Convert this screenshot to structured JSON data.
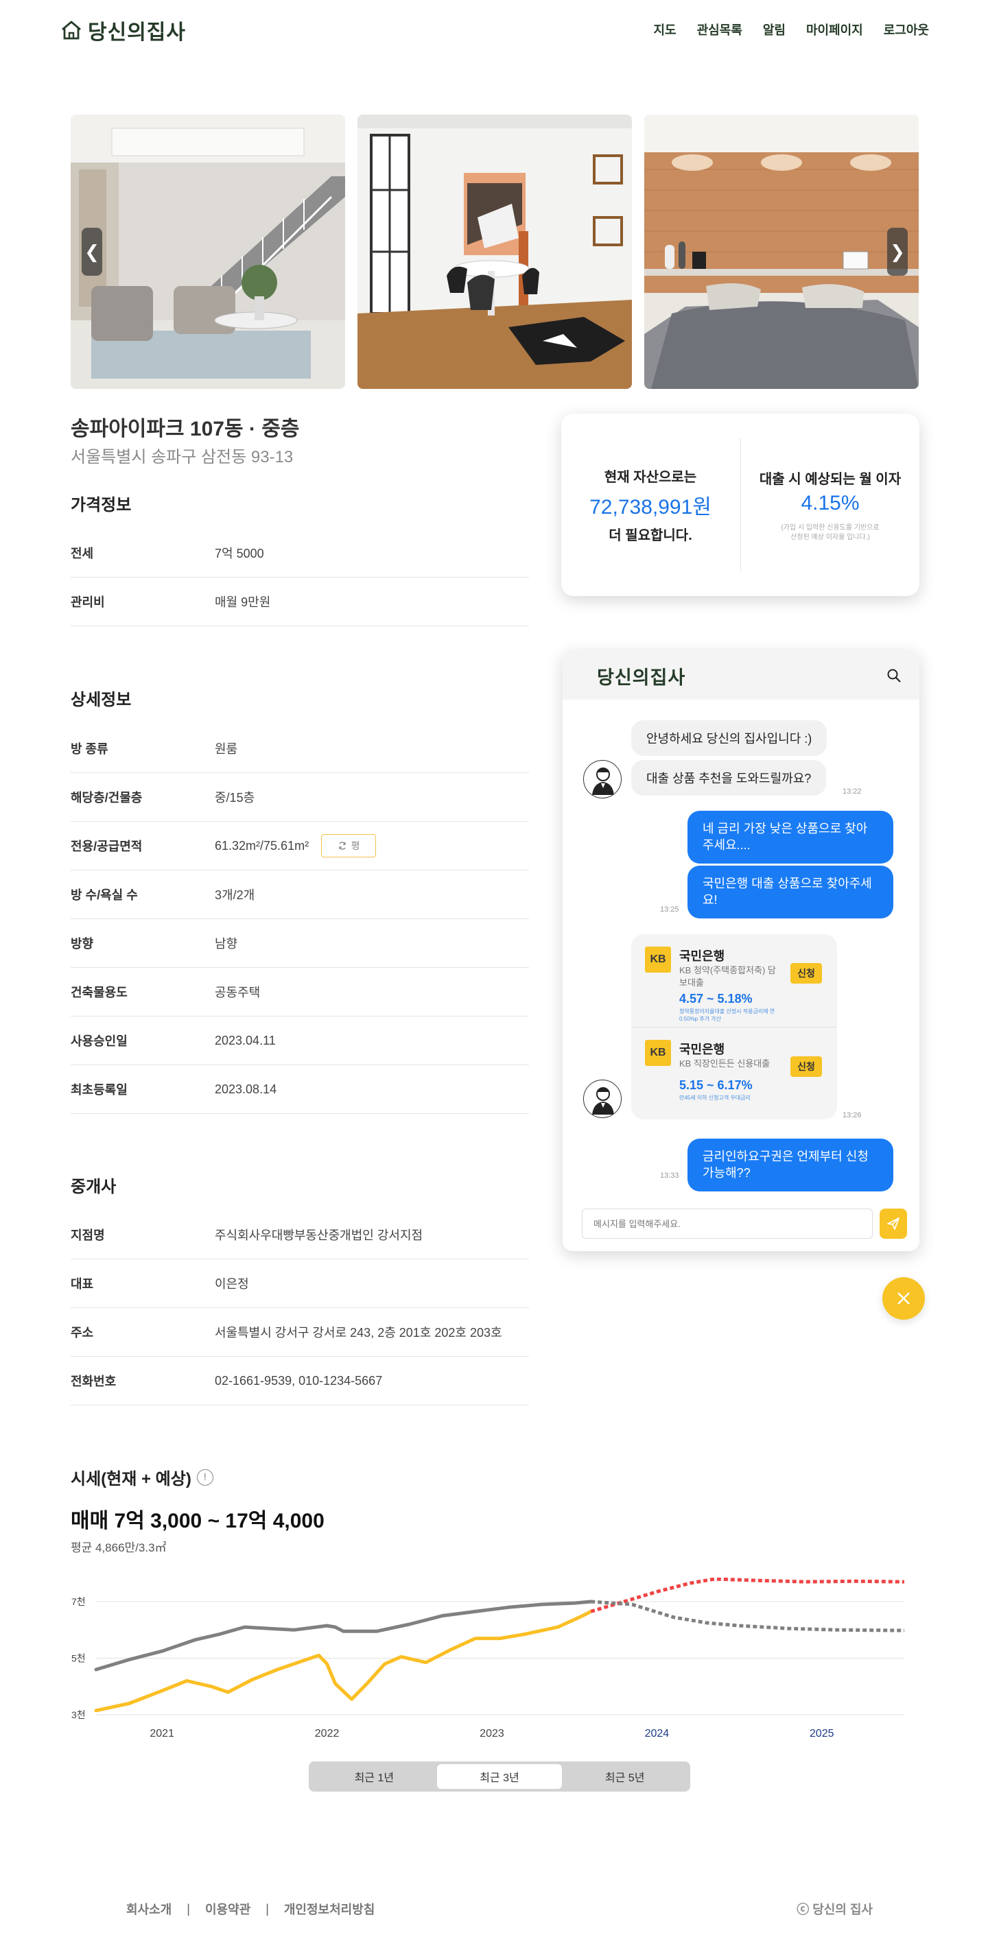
{
  "header": {
    "logo": "당신의집사",
    "nav": [
      "지도",
      "관심목록",
      "알림",
      "마이페이지",
      "로그아웃"
    ]
  },
  "gallery": {
    "prev_label": "❮",
    "next_label": "❯"
  },
  "listing": {
    "title": "송파아이파크 107동 · 중층",
    "address": "서울특별시 송파구 삼전동 93-13"
  },
  "price_info": {
    "title": "가격정보",
    "rows": [
      {
        "label": "전세",
        "value": "7억 5000"
      },
      {
        "label": "관리비",
        "value": "매월 9만원"
      }
    ]
  },
  "detail_info": {
    "title": "상세정보",
    "rows": [
      {
        "label": "방 종류",
        "value": "원룸"
      },
      {
        "label": "해당층/건물층",
        "value": "중/15층"
      },
      {
        "label": "전용/공급면적",
        "value": "61.32m²/75.61m²"
      },
      {
        "label": "방 수/욕실 수",
        "value": "3개/2개"
      },
      {
        "label": "방향",
        "value": "남향"
      },
      {
        "label": "건축물용도",
        "value": "공동주택"
      },
      {
        "label": "사용승인일",
        "value": "2023.04.11"
      },
      {
        "label": "최초등록일",
        "value": "2023.08.14"
      }
    ],
    "unit_toggle": "평"
  },
  "agency": {
    "title": "중개사",
    "rows": [
      {
        "label": "지점명",
        "value": "주식회사우대빵부동산중개법인 강서지점"
      },
      {
        "label": "대표",
        "value": "이은정"
      },
      {
        "label": "주소",
        "value": "서울특별시 강서구 강서로 243, 2층 201호 202호 203호"
      },
      {
        "label": "전화번호",
        "value": "02-1661-9539, 010-1234-5667"
      }
    ]
  },
  "loan_card": {
    "left_head": "현재 자산으로는",
    "left_amount": "72,738,991원",
    "left_tail": "더 필요합니다.",
    "right_head": "대출 시 예상되는 월 이자",
    "right_rate": "4.15%",
    "right_note": "(가입 시 입력한 신용도를 기반으로 산정된 예상 이자율 입니다.)"
  },
  "chat": {
    "logo": "당신의집사",
    "messages": {
      "bot_greeting": "안녕하세요 당신의 집사입니다 :)",
      "bot_offer": "대출 상품 추천을 도와드릴까요?",
      "time1": "13:22",
      "user_1": "네 금리 가장 낮은 상품으로 찾아주세요....",
      "user_2": "국민은행 대출 상품으로 찾아주세요!",
      "time2": "13:25",
      "time3": "13:26",
      "user_3": "금리인하요구권은 언제부터 신청 가능해??",
      "time4": "13:33"
    },
    "products": [
      {
        "bank": "국민은행",
        "name": "KB 청약(주택종합저축) 담보대출",
        "rate": "4.57 ~ 5.18%",
        "note": "청약통장이자율대출 산정시 적용금리에 연 0.50%p 추가 가산",
        "apply": "신청",
        "logo": "KB"
      },
      {
        "bank": "국민은행",
        "name": "KB 직장인든든 신용대출",
        "rate": "5.15 ~ 6.17%",
        "note": "만45세 이하 신청고객 우대금리",
        "apply": "신청",
        "logo": "KB"
      }
    ],
    "input_placeholder": "메시지를 입력해주세요."
  },
  "market": {
    "title": "시세(현재 + 예상)",
    "info_icon": "!",
    "price": "매매 7억 3,000 ~ 17억 4,000",
    "avg": "평균 4,866만/3.3㎡",
    "ranges": [
      "최근 1년",
      "최근 3년",
      "최근 5년"
    ],
    "active_range": "최근 3년"
  },
  "chart_data": {
    "type": "line",
    "x_ticks": [
      "2021",
      "2022",
      "2023",
      "2024",
      "2025"
    ],
    "y_ticks": [
      "7천",
      "5천",
      "3천"
    ],
    "ylim": [
      3000,
      7000
    ],
    "xlim": [
      2020.6,
      2025.5
    ],
    "colors": {
      "gray": "#808080",
      "yellow": "#fbbf24",
      "red": "#ef4444",
      "future_tick": "#1e3a8a"
    },
    "series": [
      {
        "style": "solid",
        "color": "#808080",
        "points": [
          [
            2020.6,
            4600
          ],
          [
            2020.8,
            4950
          ],
          [
            2021.0,
            5250
          ],
          [
            2021.2,
            5650
          ],
          [
            2021.35,
            5850
          ],
          [
            2021.5,
            6100
          ],
          [
            2021.65,
            6050
          ],
          [
            2021.8,
            6000
          ],
          [
            2022.0,
            6150
          ],
          [
            2022.05,
            6100
          ],
          [
            2022.1,
            5950
          ],
          [
            2022.3,
            5950
          ],
          [
            2022.5,
            6200
          ],
          [
            2022.7,
            6500
          ],
          [
            2022.9,
            6650
          ],
          [
            2023.1,
            6800
          ],
          [
            2023.3,
            6900
          ],
          [
            2023.5,
            6950
          ],
          [
            2023.6,
            7000
          ]
        ]
      },
      {
        "style": "solid",
        "color": "#fbbf24",
        "points": [
          [
            2020.6,
            3150
          ],
          [
            2020.8,
            3400
          ],
          [
            2021.0,
            3850
          ],
          [
            2021.15,
            4200
          ],
          [
            2021.3,
            4000
          ],
          [
            2021.4,
            3800
          ],
          [
            2021.55,
            4250
          ],
          [
            2021.7,
            4600
          ],
          [
            2021.85,
            4900
          ],
          [
            2021.95,
            5100
          ],
          [
            2022.0,
            4800
          ],
          [
            2022.05,
            4100
          ],
          [
            2022.15,
            3550
          ],
          [
            2022.25,
            4150
          ],
          [
            2022.35,
            4800
          ],
          [
            2022.45,
            5050
          ],
          [
            2022.6,
            4850
          ],
          [
            2022.75,
            5300
          ],
          [
            2022.9,
            5700
          ],
          [
            2023.05,
            5700
          ],
          [
            2023.2,
            5850
          ],
          [
            2023.4,
            6100
          ],
          [
            2023.55,
            6500
          ],
          [
            2023.6,
            6650
          ]
        ]
      },
      {
        "style": "dashed",
        "color": "#ef4444",
        "points": [
          [
            2023.6,
            6650
          ],
          [
            2023.8,
            7000
          ],
          [
            2024.0,
            7350
          ],
          [
            2024.2,
            7650
          ],
          [
            2024.35,
            7800
          ],
          [
            2024.6,
            7750
          ],
          [
            2024.9,
            7700
          ],
          [
            2025.2,
            7720
          ],
          [
            2025.5,
            7700
          ]
        ]
      },
      {
        "style": "dashed",
        "color": "#808080",
        "points": [
          [
            2023.6,
            7000
          ],
          [
            2023.85,
            6900
          ],
          [
            2024.1,
            6450
          ],
          [
            2024.3,
            6250
          ],
          [
            2024.5,
            6150
          ],
          [
            2024.8,
            6050
          ],
          [
            2025.1,
            6000
          ],
          [
            2025.5,
            5980
          ]
        ]
      }
    ]
  },
  "footer": {
    "links": [
      "회사소개",
      "이용약관",
      "개인정보처리방침"
    ],
    "copyright": "ⓒ 당신의 집사"
  }
}
